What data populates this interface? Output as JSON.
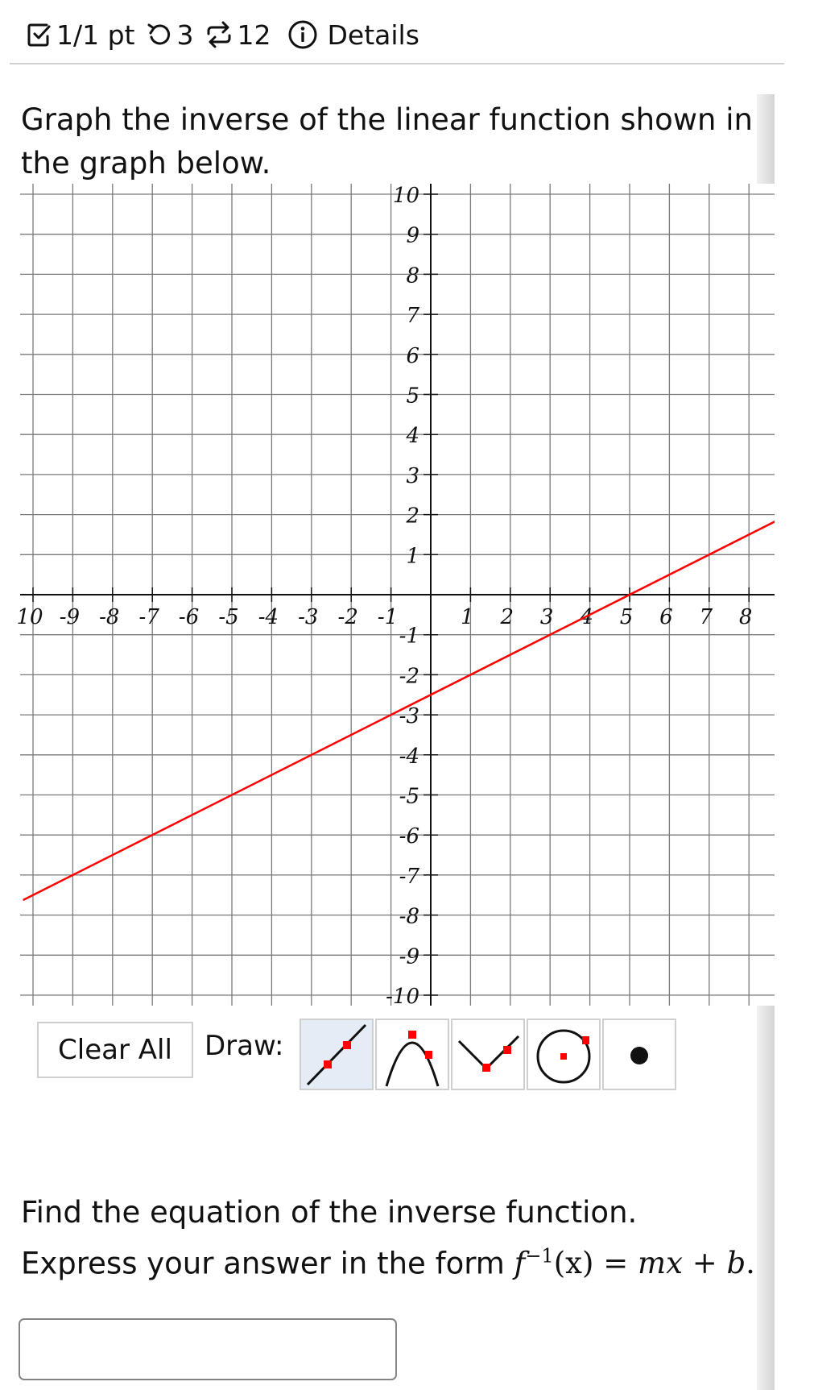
{
  "header": {
    "score": "1/1 pt",
    "retries": "3",
    "attempts": "12",
    "details_label": "Details",
    "icons": [
      "checkbox-icon",
      "undo-icon",
      "repeat-icon",
      "info-icon"
    ]
  },
  "question": {
    "prompt": "Graph the inverse of the linear function shown in the graph below.",
    "part2_text": "Find the equation of the inverse function. Express your answer in the form ",
    "part2_math": {
      "func": "f",
      "sup": "−1",
      "arg": "(x)",
      "eq": " = ",
      "rhs": "mx + b",
      "end": "."
    }
  },
  "colors": {
    "line": "#ff0000",
    "grid": "#7a7a7a",
    "axis": "#111111",
    "selected_tool_bg": "#e4edf5"
  },
  "toolbar": {
    "clear_label": "Clear All",
    "draw_label": "Draw:",
    "tools": [
      {
        "name": "line-tool",
        "selected": true
      },
      {
        "name": "parabola-tool",
        "selected": false
      },
      {
        "name": "absolute-value-tool",
        "selected": false
      },
      {
        "name": "circle-tool",
        "selected": false
      },
      {
        "name": "point-tool",
        "selected": false
      }
    ]
  },
  "answer": {
    "value": "",
    "placeholder": ""
  },
  "chart_data": {
    "type": "line",
    "title": "",
    "xlabel": "",
    "ylabel": "",
    "xlim": [
      -10,
      8.9
    ],
    "ylim": [
      -10,
      10
    ],
    "grid": true,
    "x_ticks": [
      "10",
      "-9",
      "-8",
      "-7",
      "-6",
      "-5",
      "-4",
      "-3",
      "-2",
      "-1",
      "1",
      "2",
      "3",
      "4",
      "5",
      "6",
      "7",
      "8"
    ],
    "x_tick_values": [
      -10,
      -9,
      -8,
      -7,
      -6,
      -5,
      -4,
      -3,
      -2,
      -1,
      1,
      2,
      3,
      4,
      5,
      6,
      7,
      8
    ],
    "y_ticks": [
      "10",
      "9",
      "8",
      "7",
      "6",
      "5",
      "4",
      "3",
      "2",
      "1",
      "-1",
      "-2",
      "-3",
      "-4",
      "-5",
      "-6",
      "-7",
      "-8",
      "-9",
      "-10"
    ],
    "y_tick_values": [
      10,
      9,
      8,
      7,
      6,
      5,
      4,
      3,
      2,
      1,
      -1,
      -2,
      -3,
      -4,
      -5,
      -6,
      -7,
      -8,
      -9,
      -10
    ],
    "series": [
      {
        "name": "f(x)",
        "equation": "y = 0.5x - 2.5",
        "slope": 0.5,
        "intercept": -2.5,
        "x": [
          -10.25,
          8.9
        ],
        "y": [
          -7.625,
          1.95
        ],
        "points_on_grid": [
          [
            -9,
            -7
          ],
          [
            -7,
            -6
          ],
          [
            -1,
            -3
          ],
          [
            5,
            0
          ],
          [
            7,
            1
          ]
        ]
      }
    ]
  }
}
